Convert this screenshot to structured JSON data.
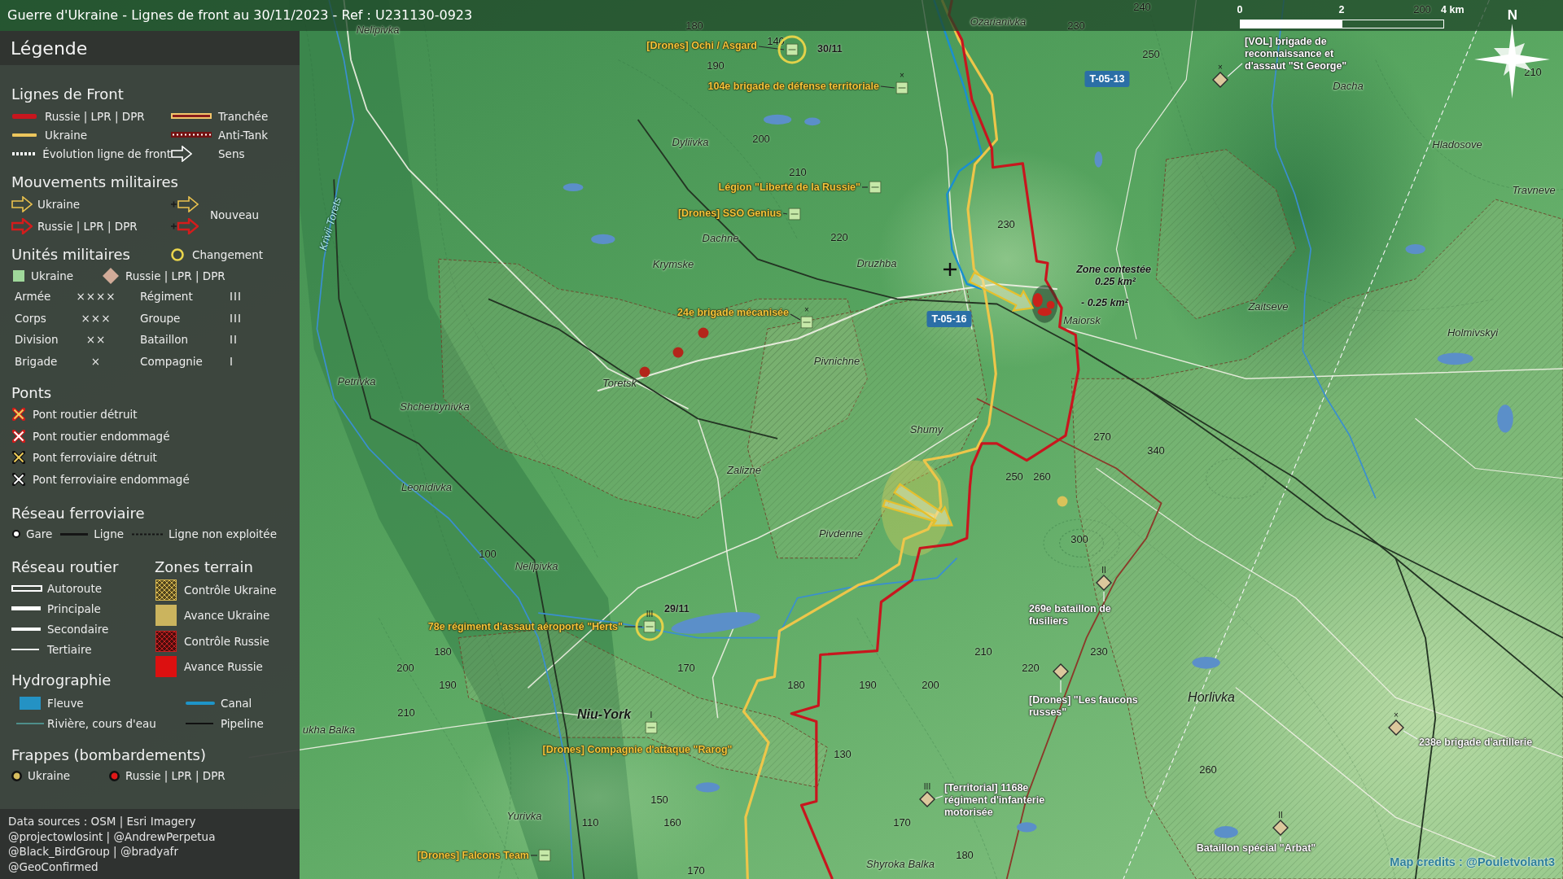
{
  "title": "Guerre d'Ukraine - Lignes de front au 30/11/2023 - Ref : U231130-0923",
  "legend": {
    "heading": "Légende",
    "front_lines": {
      "heading": "Lignes de Front",
      "items": [
        {
          "kind": "russia",
          "label": "Russie | LPR | DPR"
        },
        {
          "kind": "trench",
          "label": "Tranchée"
        },
        {
          "kind": "ukraine",
          "label": "Ukraine"
        },
        {
          "kind": "antitank",
          "label": "Anti-Tank"
        },
        {
          "kind": "evolution",
          "label": "Évolution ligne de front"
        },
        {
          "kind": "direction",
          "label": "Sens"
        }
      ]
    },
    "movements": {
      "heading": "Mouvements militaires",
      "items": [
        {
          "kind": "ukraine",
          "label": "Ukraine"
        },
        {
          "kind": "russia",
          "label": "Russie | LPR | DPR"
        }
      ],
      "new_label": "Nouveau"
    },
    "units": {
      "heading": "Unités militaires",
      "change_label": "Changement",
      "sides": [
        {
          "kind": "ukraine",
          "label": "Ukraine"
        },
        {
          "kind": "russia",
          "label": "Russie | LPR | DPR"
        }
      ],
      "echelons": [
        {
          "name": "Armée",
          "symbol": "××××"
        },
        {
          "name": "Régiment",
          "symbol": "III"
        },
        {
          "name": "Corps",
          "symbol": "×××"
        },
        {
          "name": "Groupe",
          "symbol": "III"
        },
        {
          "name": "Division",
          "symbol": "××"
        },
        {
          "name": "Bataillon",
          "symbol": "II"
        },
        {
          "name": "Brigade",
          "symbol": "×"
        },
        {
          "name": "Compagnie",
          "symbol": "I"
        }
      ]
    },
    "bridges": {
      "heading": "Ponts",
      "items": [
        {
          "kind": "road",
          "destroyed": true,
          "label": "Pont routier détruit"
        },
        {
          "kind": "road",
          "destroyed": false,
          "label": "Pont routier endommagé"
        },
        {
          "kind": "rail",
          "destroyed": true,
          "label": "Pont ferroviaire détruit"
        },
        {
          "kind": "rail",
          "destroyed": false,
          "label": "Pont ferroviaire endommagé"
        }
      ]
    },
    "rail": {
      "heading": "Réseau ferroviaire",
      "items": [
        {
          "kind": "station",
          "label": "Gare"
        },
        {
          "kind": "line",
          "label": "Ligne"
        },
        {
          "kind": "disused",
          "label": "Ligne non exploitée"
        }
      ]
    },
    "roads": {
      "heading": "Réseau routier",
      "items": [
        {
          "kind": "motorway",
          "label": "Autoroute"
        },
        {
          "kind": "primary",
          "label": "Principale"
        },
        {
          "kind": "secondary",
          "label": "Secondaire"
        },
        {
          "kind": "tertiary",
          "label": "Tertiaire"
        }
      ]
    },
    "zones": {
      "heading": "Zones terrain",
      "items": [
        {
          "kind": "hatched",
          "color": "#d8b850",
          "label": "Contrôle Ukraine"
        },
        {
          "kind": "solid",
          "color": "#cbb45e",
          "label": "Avance Ukraine"
        },
        {
          "kind": "hatched",
          "color": "#c42020",
          "label": "Contrôle Russie"
        },
        {
          "kind": "solid",
          "color": "#dc1010",
          "label": "Avance Russie"
        }
      ]
    },
    "hydrography": {
      "heading": "Hydrographie",
      "items": [
        {
          "kind": "river",
          "label": "Fleuve"
        },
        {
          "kind": "canal",
          "label": "Canal"
        },
        {
          "kind": "stream",
          "label": "Rivière, cours d'eau"
        },
        {
          "kind": "pipeline",
          "label": "Pipeline"
        }
      ]
    },
    "strikes": {
      "heading": "Frappes (bombardements)",
      "items": [
        {
          "color": "#d6bd5e",
          "label": "Ukraine"
        },
        {
          "color": "#e01818",
          "label": "Russie | LPR | DPR"
        }
      ]
    },
    "credits": [
      "Data sources : OSM | Esri Imagery",
      "@projectowlosint | @AndrewPerpetua",
      "@Black_BirdGroup | @bradyafr",
      "@GeoConfirmed"
    ]
  },
  "map": {
    "scale_bar": {
      "ticks": [
        "0",
        "2",
        "4 km"
      ]
    },
    "north": "N",
    "road_signs": [
      "T-05-13",
      "T-05-16"
    ],
    "places": [
      {
        "kind": "village",
        "name": "Nelipivka"
      },
      {
        "kind": "village",
        "name": "Ozarianivka"
      },
      {
        "kind": "village",
        "name": "Dacha"
      },
      {
        "kind": "village",
        "name": "Dyliivka"
      },
      {
        "kind": "village",
        "name": "Hladosove"
      },
      {
        "kind": "village",
        "name": "Travneve"
      },
      {
        "kind": "river",
        "name": "Krivii Torets"
      },
      {
        "kind": "village",
        "name": "Dachne"
      },
      {
        "kind": "village",
        "name": "Krymske"
      },
      {
        "kind": "village",
        "name": "Druzhba"
      },
      {
        "kind": "village",
        "name": "Zaitseve"
      },
      {
        "kind": "village",
        "name": "Maiorsk"
      },
      {
        "kind": "village",
        "name": "Holmivskyi"
      },
      {
        "kind": "village",
        "name": "Pivnichne"
      },
      {
        "kind": "village",
        "name": "Petrivka"
      },
      {
        "kind": "village",
        "name": "Toretsk"
      },
      {
        "kind": "village",
        "name": "Shcherbynivka"
      },
      {
        "kind": "village",
        "name": "Shumy"
      },
      {
        "kind": "village",
        "name": "Zalizne"
      },
      {
        "kind": "village",
        "name": "Leonidivka"
      },
      {
        "kind": "village",
        "name": "Pivdenne"
      },
      {
        "kind": "village",
        "name": "Nelipivka"
      },
      {
        "kind": "town",
        "name": "Horlivka"
      },
      {
        "kind": "city",
        "name": "Niu-York"
      },
      {
        "kind": "village",
        "name": "ukha Balka"
      },
      {
        "kind": "village",
        "name": "Yurivka"
      },
      {
        "kind": "village",
        "name": "Shyroka Balka"
      }
    ],
    "elevations": [
      "240",
      "200",
      "180",
      "230",
      "140",
      "250",
      "190",
      "210",
      "200",
      "210",
      "230",
      "220",
      "270",
      "340",
      "250",
      "260",
      "300",
      "100",
      "180",
      "210",
      "230",
      "200",
      "170",
      "220",
      "190",
      "180",
      "190",
      "200",
      "210",
      "130",
      "260",
      "150",
      "110",
      "160",
      "170",
      "180",
      "170"
    ],
    "units": [
      {
        "kind": "ukraine",
        "label": "[Drones] Ochi / Asgard",
        "changed": true,
        "date": "30/11"
      },
      {
        "kind": "ukraine",
        "label": "104e brigade de défense territoriale",
        "changed": false,
        "echelon": "×"
      },
      {
        "kind": "ukraine",
        "label": "Légion \"Liberté de la Russie\"",
        "changed": false
      },
      {
        "kind": "ukraine",
        "label": "[Drones] SSO Genius",
        "changed": false
      },
      {
        "kind": "ukraine",
        "label": "24e brigade mécanisée",
        "changed": false,
        "echelon": "×"
      },
      {
        "kind": "ukraine",
        "label": "78e régiment d'assaut aéroporté \"Herts\"",
        "changed": true,
        "date": "29/11",
        "echelon": "III"
      },
      {
        "kind": "ukraine",
        "label": "[Drones] Compagnie d'attaque \"Rarog\"",
        "changed": false,
        "echelon": "I"
      },
      {
        "kind": "ukraine",
        "label": "[Drones] Falcons Team",
        "changed": false
      },
      {
        "kind": "russia",
        "label": "[VOL] brigade de reconnaissance et d'assaut \"St George\"",
        "changed": false,
        "echelon": "×"
      },
      {
        "kind": "russia",
        "label": "269e bataillon de fusiliers",
        "changed": false,
        "echelon": "II"
      },
      {
        "kind": "russia",
        "label": "[Drones] \"Les faucons russes\"",
        "changed": false
      },
      {
        "kind": "russia",
        "label": "[Territorial] 1168e régiment d'infanterie motorisée",
        "changed": false,
        "echelon": "III"
      },
      {
        "kind": "russia",
        "label": "Bataillon spécial \"Arbat\"",
        "changed": false,
        "echelon": "II"
      },
      {
        "kind": "russia",
        "label": "238e brigade d'artillerie",
        "changed": false,
        "echelon": "×"
      }
    ],
    "contested_zone": {
      "title": "Zone contestée",
      "area": "0.25 km²",
      "change": "- 0.25 km²"
    },
    "strikes": [
      {
        "color": "#b3261a"
      },
      {
        "color": "#b3261a"
      },
      {
        "color": "#b3261a"
      },
      {
        "color": "#d9c25a"
      }
    ],
    "credits": "Map credits : @Pouletvolant3"
  }
}
